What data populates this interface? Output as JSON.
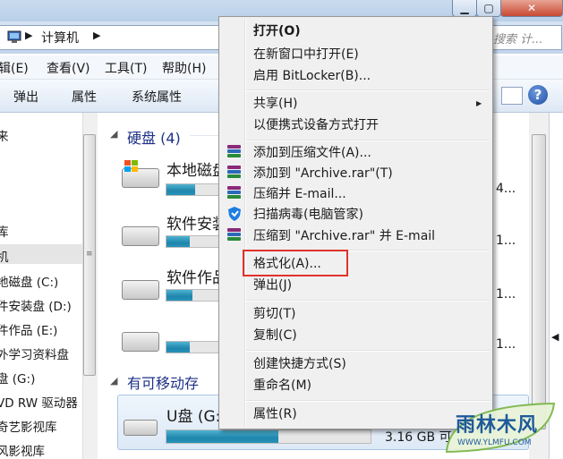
{
  "address": {
    "path": "计算机",
    "search_placeholder": "搜索 计..."
  },
  "menubar": [
    "辑(E)",
    "查看(V)",
    "工具(T)",
    "帮助(H)"
  ],
  "toolbar": {
    "eject": "弹出",
    "properties": "属性",
    "system_properties": "系统属性"
  },
  "nav": {
    "items": [
      "来",
      "库",
      "机",
      "地磁盘 (C:)",
      "件安装盘 (D:)",
      "件作品 (E:)",
      "外学习资料盘",
      "盘 (G:)",
      "VD RW 驱动器",
      "奇艺影视库",
      "风影视库"
    ]
  },
  "main": {
    "hard_disks_header": "硬盘 (4)",
    "drives": [
      {
        "name": "本地磁盘",
        "size_text": "4...",
        "fill": 0.55
      },
      {
        "name": "软件安装",
        "size_text": "1...",
        "fill": 0.45
      },
      {
        "name": "软件作品",
        "size_text": "1...",
        "fill": 0.5
      },
      {
        "name": "",
        "size_text": "1...",
        "fill": 0.45
      }
    ],
    "removable_header": "有可移动存",
    "usb": {
      "name": "U盘 (G:",
      "free_text": "3.16 GB 可",
      "fill": 0.55
    }
  },
  "context_menu": {
    "items": [
      {
        "label": "打开(O)",
        "bold": true
      },
      {
        "label": "在新窗口中打开(E)"
      },
      {
        "label": "启用 BitLocker(B)..."
      },
      {
        "label": "共享(H)",
        "submenu": true
      },
      {
        "label": "以便携式设备方式打开"
      },
      {
        "label": "添加到压缩文件(A)..."
      },
      {
        "label": "添加到 \"Archive.rar\"(T)"
      },
      {
        "label": "压缩并 E-mail..."
      },
      {
        "label": "扫描病毒(电脑管家)"
      },
      {
        "label": "压缩到 \"Archive.rar\" 并 E-mail"
      },
      {
        "label": "格式化(A)...",
        "highlighted": true
      },
      {
        "label": "弹出(J)"
      },
      {
        "label": "剪切(T)"
      },
      {
        "label": "复制(C)"
      },
      {
        "label": "创建快捷方式(S)"
      },
      {
        "label": "重命名(M)"
      },
      {
        "label": "属性(R)"
      }
    ],
    "highlight_color": "#e0322c"
  },
  "watermark": {
    "title": "雨林木风",
    "url": "WWW.YLMFU.COM"
  },
  "colors": {
    "accent_blue": "#1e3287",
    "bar_blue": "#1f86ad"
  }
}
